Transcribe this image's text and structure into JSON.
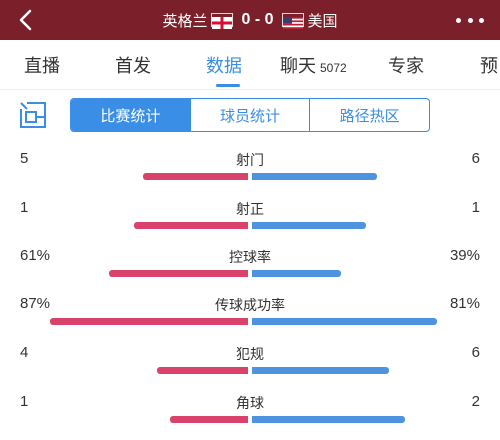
{
  "header": {
    "home_team": "英格兰",
    "score": "0 - 0",
    "away_team": "美国"
  },
  "tabs": [
    {
      "label": "直播"
    },
    {
      "label": "首发"
    },
    {
      "label": "数据"
    },
    {
      "label": "聊天",
      "count": "5072"
    },
    {
      "label": "专家"
    },
    {
      "label": "预"
    }
  ],
  "subtabs": [
    {
      "label": "比赛统计"
    },
    {
      "label": "球员统计"
    },
    {
      "label": "路径热区"
    }
  ],
  "colors": {
    "header_bg": "#7b1f2a",
    "accent": "#3a8ee6",
    "home_bar": "#d9436b",
    "away_bar": "#4d93e0"
  },
  "stats": [
    {
      "label": "射门",
      "left": "5",
      "right": "6",
      "left_frac": 0.46,
      "right_frac": 0.55
    },
    {
      "label": "射正",
      "left": "1",
      "right": "1",
      "left_frac": 0.5,
      "right_frac": 0.5
    },
    {
      "label": "控球率",
      "left": "61%",
      "right": "39%",
      "left_frac": 0.61,
      "right_frac": 0.39
    },
    {
      "label": "传球成功率",
      "left": "87%",
      "right": "81%",
      "left_frac": 0.87,
      "right_frac": 0.81
    },
    {
      "label": "犯规",
      "left": "4",
      "right": "6",
      "left_frac": 0.4,
      "right_frac": 0.6
    },
    {
      "label": "角球",
      "left": "1",
      "right": "2",
      "left_frac": 0.34,
      "right_frac": 0.67
    }
  ]
}
